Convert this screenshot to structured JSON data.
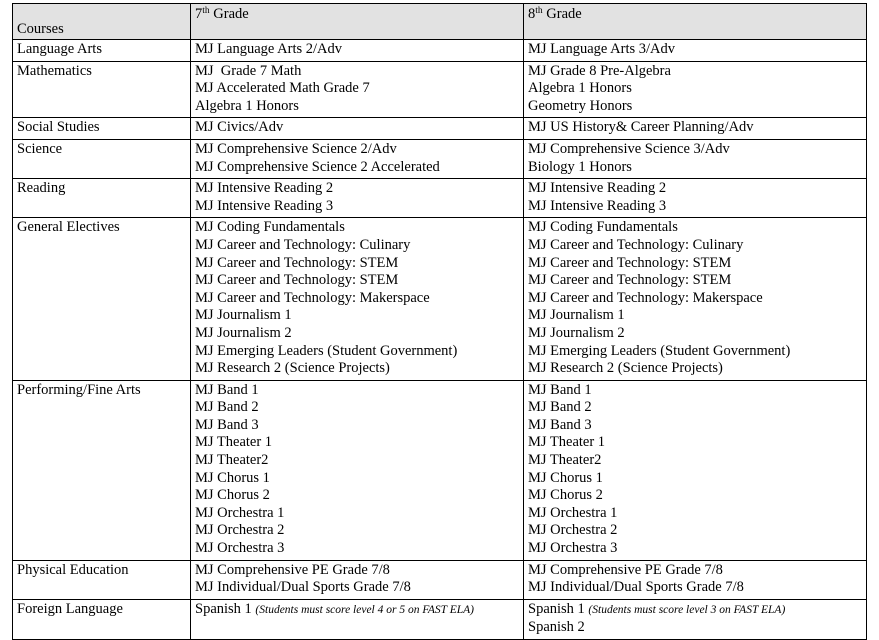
{
  "table": {
    "headers": {
      "courses": "Courses",
      "grade7_prefix": "7",
      "grade7_sup": "th",
      "grade7_suffix": " Grade",
      "grade8_prefix": "8",
      "grade8_sup": "th",
      "grade8_suffix": " Grade"
    },
    "header_background": "#E2E2E2",
    "border_color": "#000000",
    "rows": [
      {
        "subject": "Language Arts",
        "grade7": [
          "MJ Language Arts 2/Adv"
        ],
        "grade8": [
          "MJ Language Arts 3/Adv"
        ]
      },
      {
        "subject": "Mathematics",
        "grade7": [
          "MJ  Grade 7 Math",
          "MJ Accelerated Math Grade 7",
          "Algebra 1 Honors"
        ],
        "grade8": [
          "MJ Grade 8 Pre-Algebra",
          "Algebra 1 Honors",
          "Geometry Honors"
        ]
      },
      {
        "subject": "Social Studies",
        "grade7": [
          "MJ Civics/Adv"
        ],
        "grade8": [
          "MJ US History& Career Planning/Adv"
        ]
      },
      {
        "subject": "Science",
        "grade7": [
          "MJ Comprehensive Science 2/Adv",
          "MJ Comprehensive Science 2 Accelerated"
        ],
        "grade8": [
          "MJ Comprehensive Science 3/Adv",
          "Biology 1 Honors"
        ]
      },
      {
        "subject": "Reading",
        "grade7": [
          "MJ Intensive Reading 2",
          "MJ Intensive Reading 3"
        ],
        "grade8": [
          "MJ Intensive Reading 2",
          "MJ Intensive Reading 3"
        ]
      },
      {
        "subject": "General Electives",
        "grade7": [
          "MJ Coding Fundamentals",
          "MJ Career and Technology: Culinary",
          "MJ Career and Technology: STEM",
          "MJ Career and Technology: STEM",
          "MJ Career and Technology: Makerspace",
          "MJ Journalism 1",
          "MJ Journalism 2",
          "MJ Emerging Leaders (Student Government)",
          "MJ Research 2 (Science Projects)"
        ],
        "grade8": [
          "MJ Coding Fundamentals",
          "MJ Career and Technology: Culinary",
          "MJ Career and Technology: STEM",
          "MJ Career and Technology: STEM",
          "MJ Career and Technology: Makerspace",
          "MJ Journalism 1",
          "MJ Journalism 2",
          "MJ Emerging Leaders (Student Government)",
          "MJ Research 2 (Science Projects)"
        ]
      },
      {
        "subject": "Performing/Fine Arts",
        "grade7": [
          "MJ Band 1",
          "MJ Band 2",
          "MJ Band 3",
          "MJ Theater 1",
          "MJ Theater2",
          "MJ Chorus 1",
          "MJ Chorus 2",
          "MJ Orchestra 1",
          "MJ Orchestra 2",
          "MJ Orchestra 3"
        ],
        "grade8": [
          "MJ Band 1",
          "MJ Band 2",
          "MJ Band 3",
          "MJ Theater 1",
          "MJ Theater2",
          "MJ Chorus 1",
          "MJ Chorus 2",
          "MJ Orchestra 1",
          "MJ Orchestra 2",
          "MJ Orchestra 3"
        ]
      },
      {
        "subject": "Physical Education",
        "grade7": [
          "MJ Comprehensive PE Grade 7/8",
          "MJ Individual/Dual Sports Grade 7/8"
        ],
        "grade8": [
          "MJ Comprehensive PE Grade 7/8",
          "MJ Individual/Dual Sports Grade 7/8"
        ]
      },
      {
        "subject": "Foreign Language",
        "grade7": [
          "Spanish 1 "
        ],
        "grade7_notes": [
          "(Students must score level 4 or 5 on FAST ELA)"
        ],
        "grade8": [
          "Spanish 1 ",
          "Spanish 2"
        ],
        "grade8_notes": [
          "(Students must score level 3 on FAST ELA)",
          ""
        ]
      }
    ]
  }
}
